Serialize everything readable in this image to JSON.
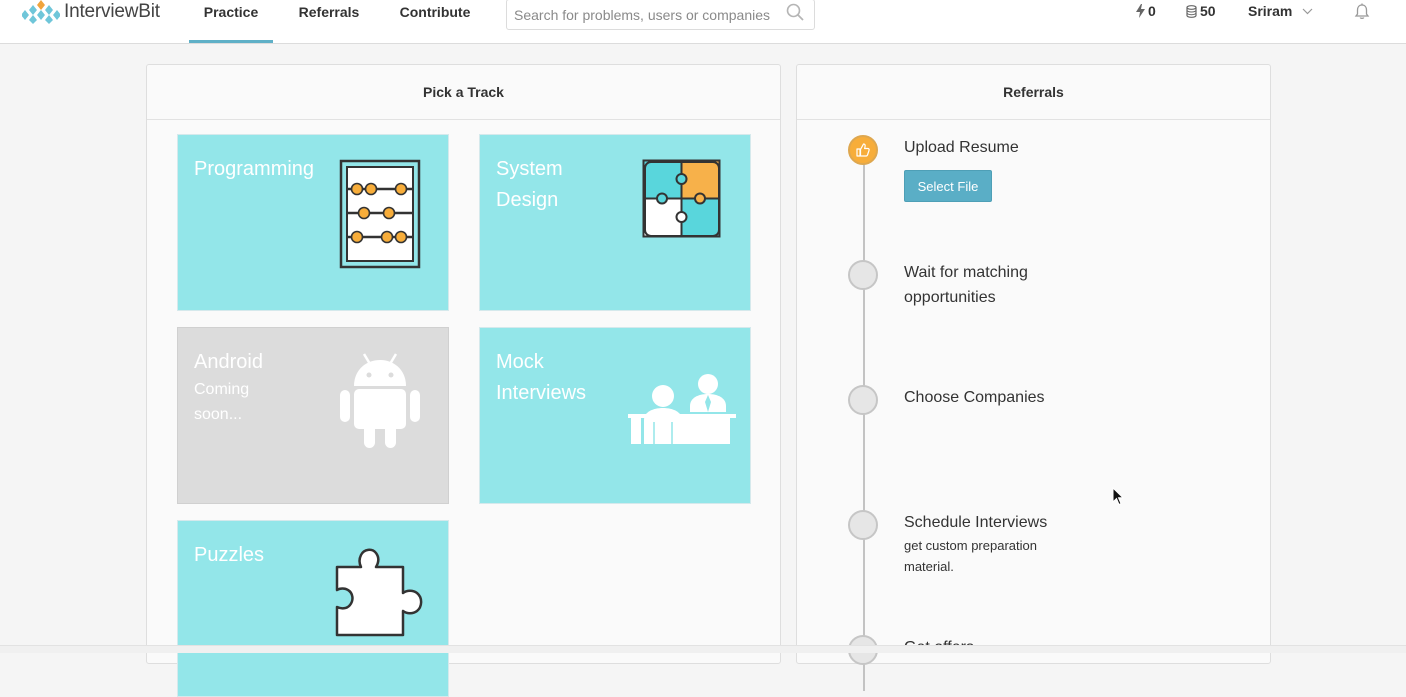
{
  "brand": {
    "name": "InterviewBit"
  },
  "nav": {
    "items": [
      {
        "label": "Practice",
        "active": true
      },
      {
        "label": "Referrals",
        "active": false
      },
      {
        "label": "Contribute",
        "active": false
      }
    ],
    "search_placeholder": "Search for problems, users or companies",
    "stats": {
      "streak": "0",
      "coins": "50"
    },
    "user_name": "Sriram"
  },
  "tracks": {
    "title": "Pick a Track",
    "items": [
      {
        "title": "Programming",
        "subtitle": "",
        "icon": "abacus-icon",
        "disabled": false
      },
      {
        "title": "System Design",
        "subtitle": "",
        "icon": "puzzle-grid-icon",
        "disabled": false
      },
      {
        "title": "Android",
        "subtitle": "Coming soon...",
        "icon": "android-icon",
        "disabled": true
      },
      {
        "title": "Mock Interviews",
        "subtitle": "",
        "icon": "interview-desk-icon",
        "disabled": false
      },
      {
        "title": "Puzzles",
        "subtitle": "",
        "icon": "puzzle-piece-icon",
        "disabled": false
      }
    ]
  },
  "referrals": {
    "title": "Referrals",
    "steps": [
      {
        "title": "Upload Resume",
        "subtitle": "",
        "button": "Select File",
        "active": true
      },
      {
        "title": "Wait for matching opportunities",
        "subtitle": "",
        "active": false
      },
      {
        "title": "Choose Companies",
        "subtitle": "",
        "active": false
      },
      {
        "title": "Schedule Interviews",
        "subtitle": "get custom preparation material.",
        "active": false
      },
      {
        "title": "Get offers",
        "subtitle": "",
        "active": false
      }
    ]
  },
  "colors": {
    "accent": "#5fb0c7",
    "tile": "#93e6e9",
    "tile_disabled": "#dcdcdc",
    "orange": "#f7ad3a",
    "button": "#5aaec6"
  }
}
